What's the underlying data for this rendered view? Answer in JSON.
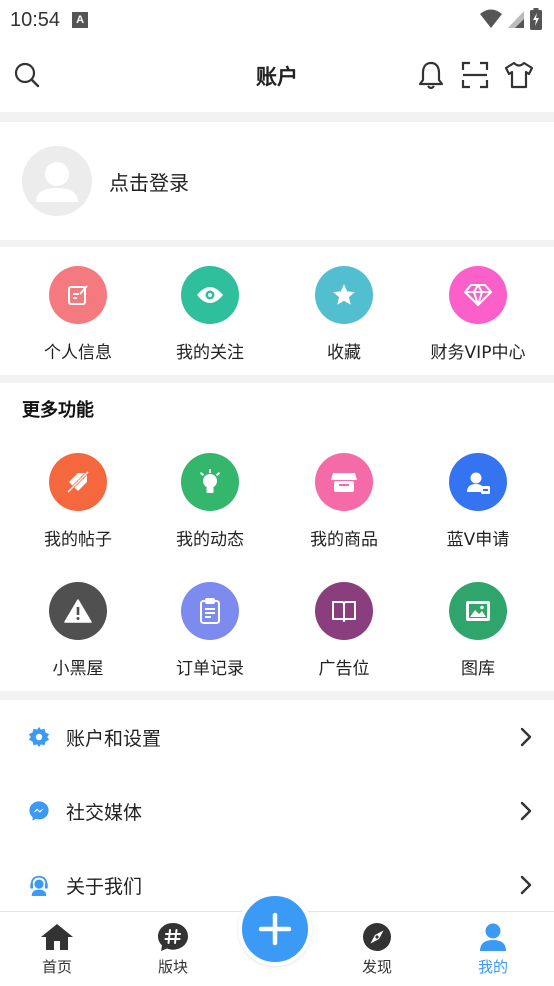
{
  "status_bar": {
    "time": "10:54",
    "notif_letter": "A"
  },
  "header": {
    "title": "账户"
  },
  "login": {
    "prompt": "点击登录"
  },
  "quick_actions": [
    {
      "label": "个人信息",
      "color": "#f47a7f",
      "icon": "edit-icon"
    },
    {
      "label": "我的关注",
      "color": "#2fbf9c",
      "icon": "eye-icon"
    },
    {
      "label": "收藏",
      "color": "#52bfd0",
      "icon": "star-icon"
    },
    {
      "label": "财务VIP中心",
      "color": "#fb5fca",
      "icon": "diamond-icon"
    }
  ],
  "more_features": {
    "title": "更多功能",
    "items": [
      {
        "label": "我的帖子",
        "color": "#f5673d",
        "icon": "tag-off-icon"
      },
      {
        "label": "我的动态",
        "color": "#34b66d",
        "icon": "lightbulb-icon"
      },
      {
        "label": "我的商品",
        "color": "#f46ba7",
        "icon": "store-icon"
      },
      {
        "label": "蓝V申请",
        "color": "#3574f0",
        "icon": "user-badge-icon"
      },
      {
        "label": "小黑屋",
        "color": "#505050",
        "icon": "warning-icon"
      },
      {
        "label": "订单记录",
        "color": "#7d8bee",
        "icon": "clipboard-icon"
      },
      {
        "label": "广告位",
        "color": "#8b3e7e",
        "icon": "book-icon"
      },
      {
        "label": "图库",
        "color": "#2fa56c",
        "icon": "image-icon"
      }
    ]
  },
  "menu": [
    {
      "label": "账户和设置",
      "icon": "gear-icon"
    },
    {
      "label": "社交媒体",
      "icon": "messenger-icon"
    },
    {
      "label": "关于我们",
      "icon": "support-agent-icon"
    }
  ],
  "tabs": [
    {
      "label": "首页",
      "icon": "home-icon"
    },
    {
      "label": "版块",
      "icon": "hashtag-icon"
    },
    {
      "label": "发现",
      "icon": "compass-icon"
    },
    {
      "label": "我的",
      "icon": "person-icon"
    }
  ],
  "colors": {
    "accent": "#3b9af5",
    "active_tab": "#3b9af5"
  }
}
